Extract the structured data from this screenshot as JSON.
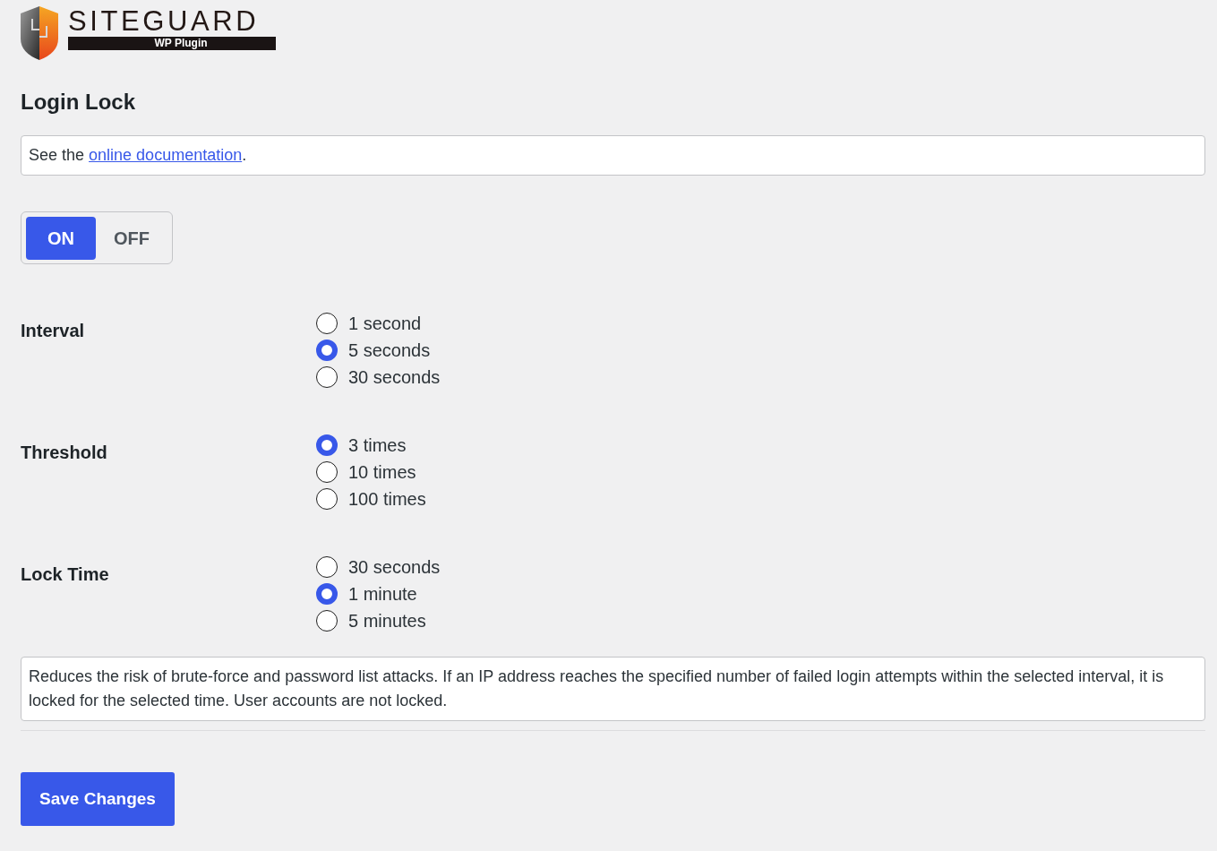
{
  "logo": {
    "name": "SITEGUARD",
    "tagline": "WP Plugin"
  },
  "title": "Login Lock",
  "notice": {
    "prefix": "See the ",
    "link": "online documentation",
    "suffix": "."
  },
  "toggle": [
    {
      "label": "ON",
      "selected": true
    },
    {
      "label": "OFF",
      "selected": false
    }
  ],
  "settings": [
    {
      "label": "Interval",
      "options": [
        {
          "label": "1 second",
          "selected": false
        },
        {
          "label": "5 seconds",
          "selected": true
        },
        {
          "label": "30 seconds",
          "selected": false
        }
      ]
    },
    {
      "label": "Threshold",
      "options": [
        {
          "label": "3 times",
          "selected": true
        },
        {
          "label": "10 times",
          "selected": false
        },
        {
          "label": "100 times",
          "selected": false
        }
      ]
    },
    {
      "label": "Lock Time",
      "options": [
        {
          "label": "30 seconds",
          "selected": false
        },
        {
          "label": "1 minute",
          "selected": true
        },
        {
          "label": "5 minutes",
          "selected": false
        }
      ]
    }
  ],
  "description": "Reduces the risk of brute-force and password list attacks. If an IP address reaches the specified number of failed login attempts within the selected interval, it is locked for the selected time. User accounts are not locked.",
  "save_button": {
    "label": "Save Changes"
  }
}
